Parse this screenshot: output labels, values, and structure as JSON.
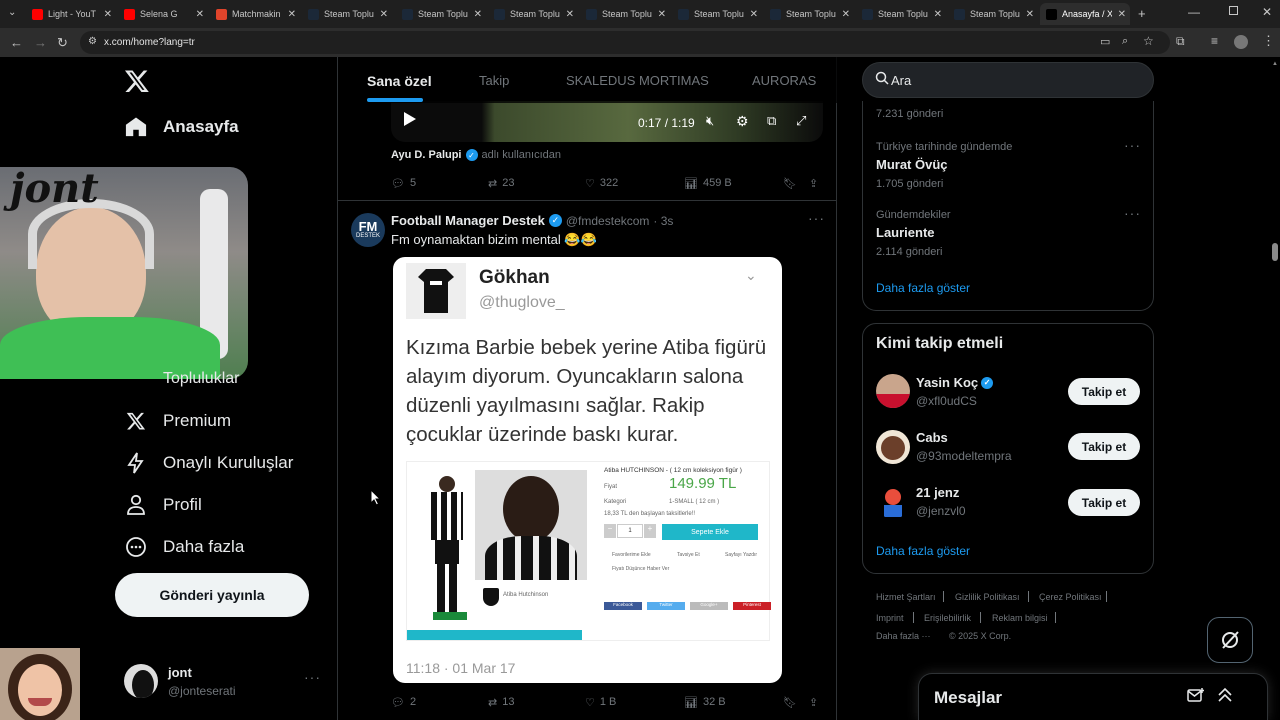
{
  "browser": {
    "tabs": [
      {
        "label": "Light - YouT",
        "color": "#ff0000"
      },
      {
        "label": "Selena G",
        "color": "#ff0000"
      },
      {
        "label": "Matchmakin",
        "color": "#e0442b"
      },
      {
        "label": "Steam Toplu",
        "color": "#1b2838"
      },
      {
        "label": "Steam Toplu",
        "color": "#1b2838"
      },
      {
        "label": "Steam Toplu",
        "color": "#1b2838"
      },
      {
        "label": "Steam Toplu",
        "color": "#1b2838"
      },
      {
        "label": "Steam Toplu",
        "color": "#1b2838"
      },
      {
        "label": "Steam Toplu",
        "color": "#1b2838"
      },
      {
        "label": "Steam Toplu",
        "color": "#1b2838"
      },
      {
        "label": "Steam Toplu",
        "color": "#1b2838"
      },
      {
        "label": "Anasayfa / X",
        "color": "#000000"
      }
    ],
    "url": "x.com/home?lang=tr"
  },
  "sidebar": {
    "home": "Anasayfa",
    "lists_partial": "Topluluklar",
    "premium": "Premium",
    "verified_orgs": "Onaylı Kuruluşlar",
    "profile": "Profil",
    "more": "Daha fazla",
    "post_button": "Gönderi yayınla",
    "account_name": "jont",
    "account_handle": "@jonteserati"
  },
  "timeline": {
    "tabs": [
      "Sana özel",
      "Takip",
      "SKALEDUS MORTIMAS",
      "AURORAS"
    ],
    "video_time": "0:17 / 1:19",
    "prev_post": {
      "author": "Ayu D. Palupi",
      "note": "adlı kullanıcıdan",
      "replies": "5",
      "reposts": "23",
      "likes": "322",
      "views": "459 B"
    },
    "post": {
      "author": "Football Manager Destek",
      "handle": "@fmdestekcom",
      "time": "· 3s",
      "avatar_text": "FM",
      "avatar_sub": "DESTEK",
      "text": "Fm oynamaktan bizim mental 😂😂",
      "embed": {
        "name": "Gökhan",
        "handle": "@thuglove_",
        "body": "Kızıma Barbie bebek yerine Atiba figürü alayım diyorum. Oyuncakların salona düzenli yayılmasını sağlar. Rakip çocuklar üzerinde baskı kurar.",
        "product_title": "Atiba HUTCHINSON - ( 12 cm koleksiyon figür )",
        "price_label": "Fiyat",
        "price": "149.99 TL",
        "category_label": "Kategori",
        "category": "1-SMALL ( 12 cm )",
        "installment": "18,33 TL den başlayan taksitlerle!!",
        "qty": "1",
        "add_cart": "Sepete Ekle",
        "fav": "Favorilerime Ekle",
        "recommend": "Tavsiye Et",
        "print": "Sayfayı Yazdır",
        "price_alert": "Fiyatı Düşünce Haber Ver",
        "caption": "Atiba Hutchinson",
        "share_fb": "Facebook",
        "share_tw": "Twitter",
        "share_g": "Google+",
        "share_p": "Pinterest",
        "timestamp": "11:18 · 01 Mar 17"
      },
      "replies": "2",
      "reposts": "13",
      "likes": "1 B",
      "views": "32 B"
    }
  },
  "right": {
    "search_placeholder": "Ara",
    "trends": [
      {
        "context": "",
        "title": "",
        "count": "7.231 gönderi"
      },
      {
        "context": "Türkiye tarihinde gündemde",
        "title": "Murat Övüç",
        "count": "1.705 gönderi"
      },
      {
        "context": "Gündemdekiler",
        "title": "Laurien­te",
        "count": "2.114 gönderi"
      }
    ],
    "show_more": "Daha fazla göster",
    "who_to_follow_title": "Kimi takip etmeli",
    "follow": [
      {
        "name": "Yasin Koç",
        "handle": "@xfl0udCS",
        "verified": true,
        "btn": "Takip et"
      },
      {
        "name": "Cabs",
        "handle": "@93modeltempra",
        "verified": false,
        "btn": "Takip et"
      },
      {
        "name": "21 jenz",
        "handle": "@jenzvl0",
        "verified": false,
        "btn": "Takip et"
      }
    ],
    "show_more2": "Daha fazla göster",
    "footer": {
      "terms": "Hizmet Şartları",
      "privacy": "Gizlilik Politikası",
      "cookie": "Çerez Politikası",
      "imprint": "Imprint",
      "access": "Erişilebilirlik",
      "ads": "Reklam bilgisi",
      "more": "Daha fazla ···",
      "copyright": "© 2025 X Corp."
    },
    "messages": "Mesajlar"
  },
  "colors": {
    "accent": "#1d9bf0",
    "bg": "#000000",
    "border": "#2f3336",
    "muted": "#71767b",
    "price": "#4aa648"
  }
}
